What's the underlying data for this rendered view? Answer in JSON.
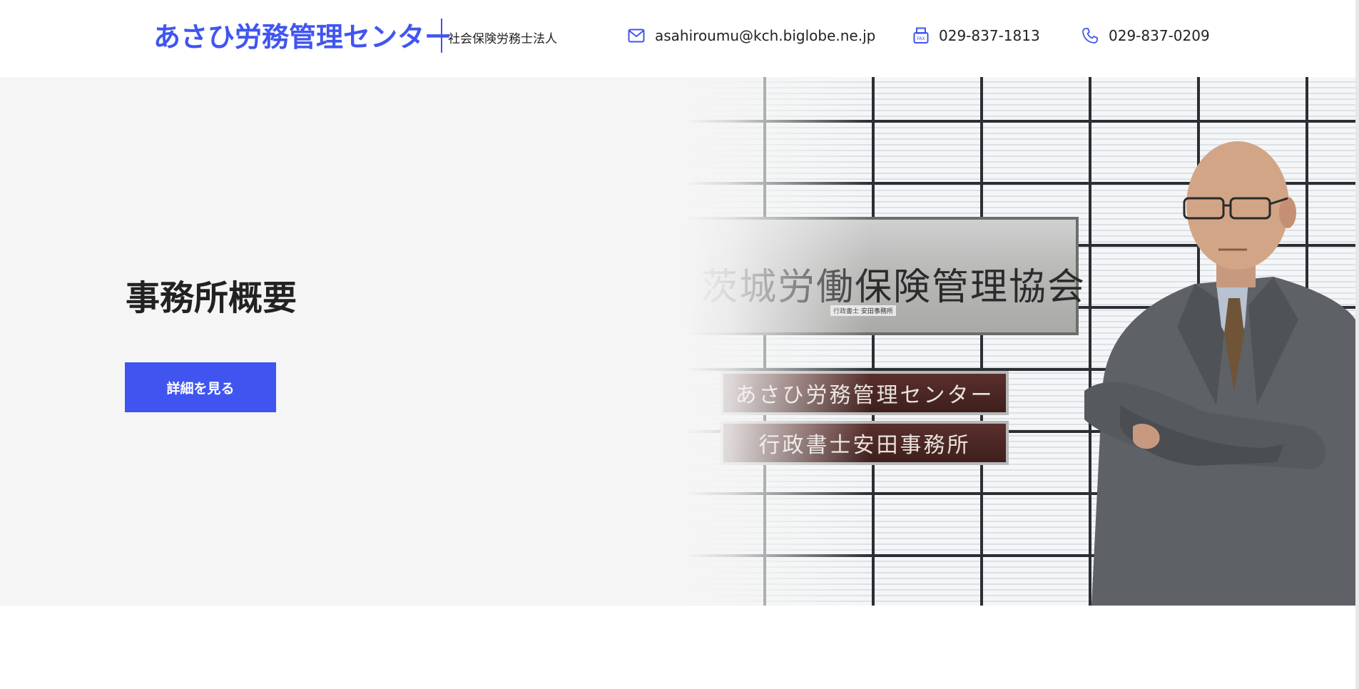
{
  "header": {
    "logo_text": "あさひ労務管理センター",
    "logo_subtitle": "社会保険労務士法人",
    "email": "asahiroumu@kch.biglobe.ne.jp",
    "fax": "029-837-1813",
    "tel": "029-837-0209",
    "accent_color": "#4055f0"
  },
  "hero": {
    "title": "事務所概要",
    "button_label": "詳細を見る",
    "background_color": "#f5f5f5"
  },
  "photo": {
    "sign_main": "茨城労働保険管理協会",
    "sign_main_small": "行政書士 安田事務所",
    "plate_1": "あさひ労務管理センター",
    "plate_2": "行政書士安田事務所"
  },
  "icons": {
    "email": "mail-icon",
    "fax": "fax-icon",
    "tel": "phone-icon"
  }
}
